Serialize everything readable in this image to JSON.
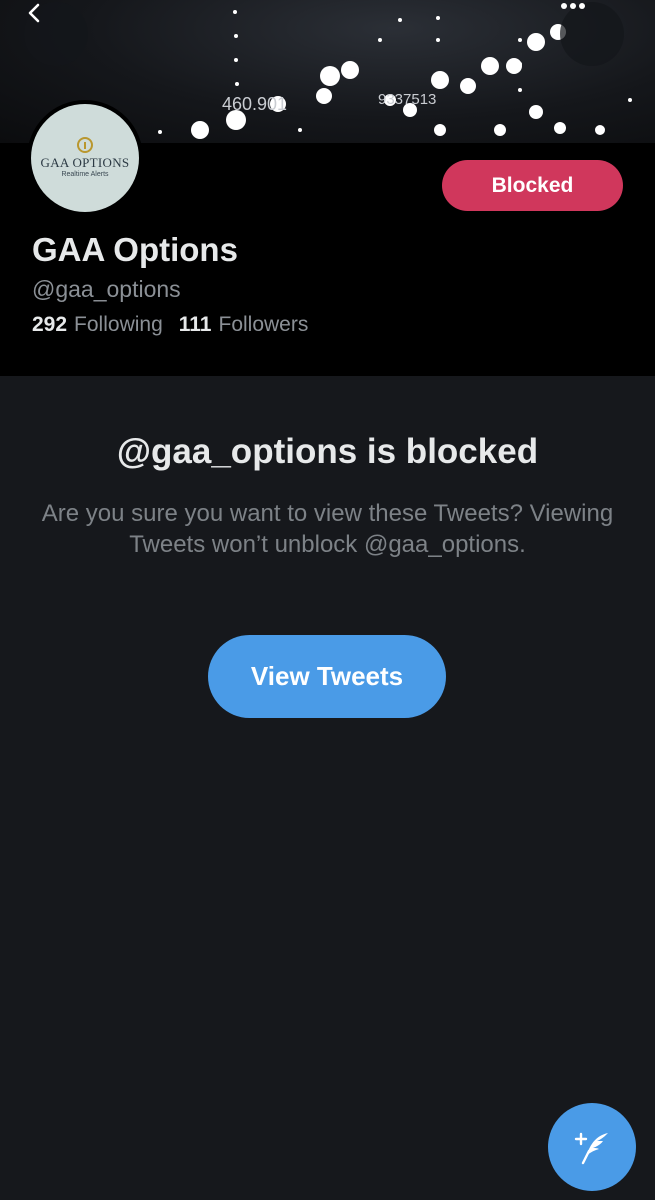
{
  "header": {
    "back_icon": "chevron-left-icon",
    "more_icon": "more-horizontal-icon",
    "banner_numbers": [
      "460.901",
      "9337513"
    ]
  },
  "profile": {
    "avatar": {
      "logo_name": "GAA OPTIONS",
      "logo_tagline": "Realtime Alerts"
    },
    "blocked_label": "Blocked",
    "display_name": "GAA Options",
    "handle": "@gaa_options",
    "following_count": "292",
    "following_label": "Following",
    "followers_count": "111",
    "followers_label": "Followers"
  },
  "blocked_notice": {
    "title": "@gaa_options is blocked",
    "description": "Are you sure you want to view these Tweets? Viewing Tweets won’t unblock @gaa_options.",
    "view_button_label": "View Tweets"
  },
  "fab": {
    "icon": "compose-tweet-icon"
  },
  "colors": {
    "accent": "#4a9be7",
    "blocked": "#d0375c",
    "background": "#16181c",
    "profile_background": "#000000",
    "muted_text": "#8b9096"
  }
}
